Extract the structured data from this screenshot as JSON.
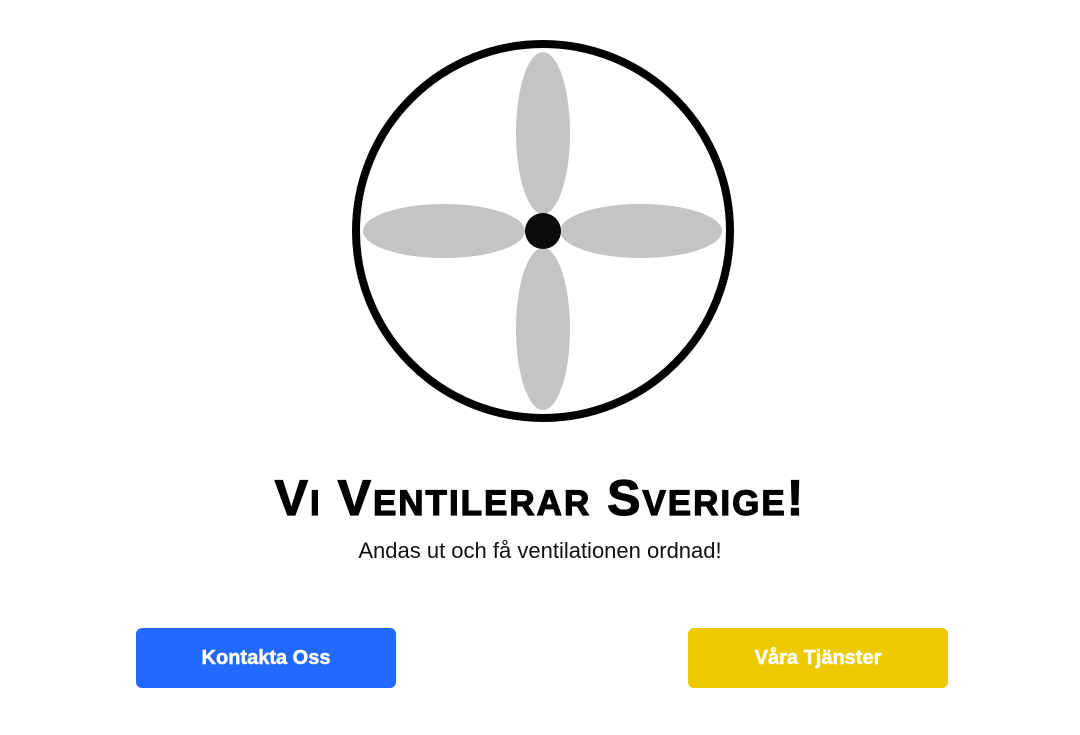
{
  "logo": {
    "icon": "fan-icon",
    "ring_color": "#000000",
    "blade_color": "#c4c4c4",
    "hub_color": "#0b0b0b"
  },
  "hero": {
    "title": "Vi Ventilerar Sverige!",
    "subtitle": "Andas ut och få ventilationen ordnad!"
  },
  "buttons": {
    "contact": {
      "label": "Kontakta Oss",
      "color": "#2269ff"
    },
    "services": {
      "label": "Våra Tjänster",
      "color": "#eec900"
    }
  }
}
